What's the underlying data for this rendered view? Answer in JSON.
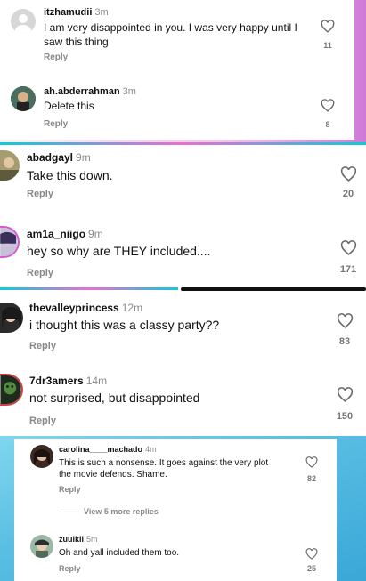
{
  "panels": [
    {
      "comments": [
        {
          "username": "itzhamudii",
          "time": "3m",
          "text": "I am very disappointed in you. I was very happy until I\nsaw this thing",
          "reply": "Reply",
          "likes": "11"
        },
        {
          "username": "ah.abderrahman",
          "time": "3m",
          "text": "Delete this",
          "reply": "Reply",
          "likes": "8"
        }
      ]
    },
    {
      "comments": [
        {
          "username": "abadgayl",
          "time": "9m",
          "text": "Take this down.",
          "reply": "Reply",
          "likes": "20"
        },
        {
          "username": "am1a_niigo",
          "time": "9m",
          "text": "hey so why are THEY included....",
          "reply": "Reply",
          "likes": "171"
        }
      ]
    },
    {
      "comments": [
        {
          "username": "thevalleyprincess",
          "time": "12m",
          "text": "i thought this was a classy party??",
          "reply": "Reply",
          "likes": "83"
        },
        {
          "username": "7dr3amers",
          "time": "14m",
          "text": "not surprised, but disappointed",
          "reply": "Reply",
          "likes": "150"
        }
      ]
    },
    {
      "comments": [
        {
          "username": "carolina____machado",
          "time": "4m",
          "text": "This is such a nonsense. It goes against the very plot\nthe movie defends. Shame.",
          "reply": "Reply",
          "likes": "82"
        },
        {
          "username": "zuuikii",
          "time": "5m",
          "text": "Oh and yall included them too.",
          "reply": "Reply",
          "likes": "25"
        }
      ],
      "view_more": "View 5 more replies"
    }
  ],
  "colors": {
    "accent_pink": "#e86fd4",
    "accent_cyan": "#10c9d6",
    "muted": "#8a8a8a"
  },
  "icons": {
    "like": "heart-outline-icon"
  }
}
